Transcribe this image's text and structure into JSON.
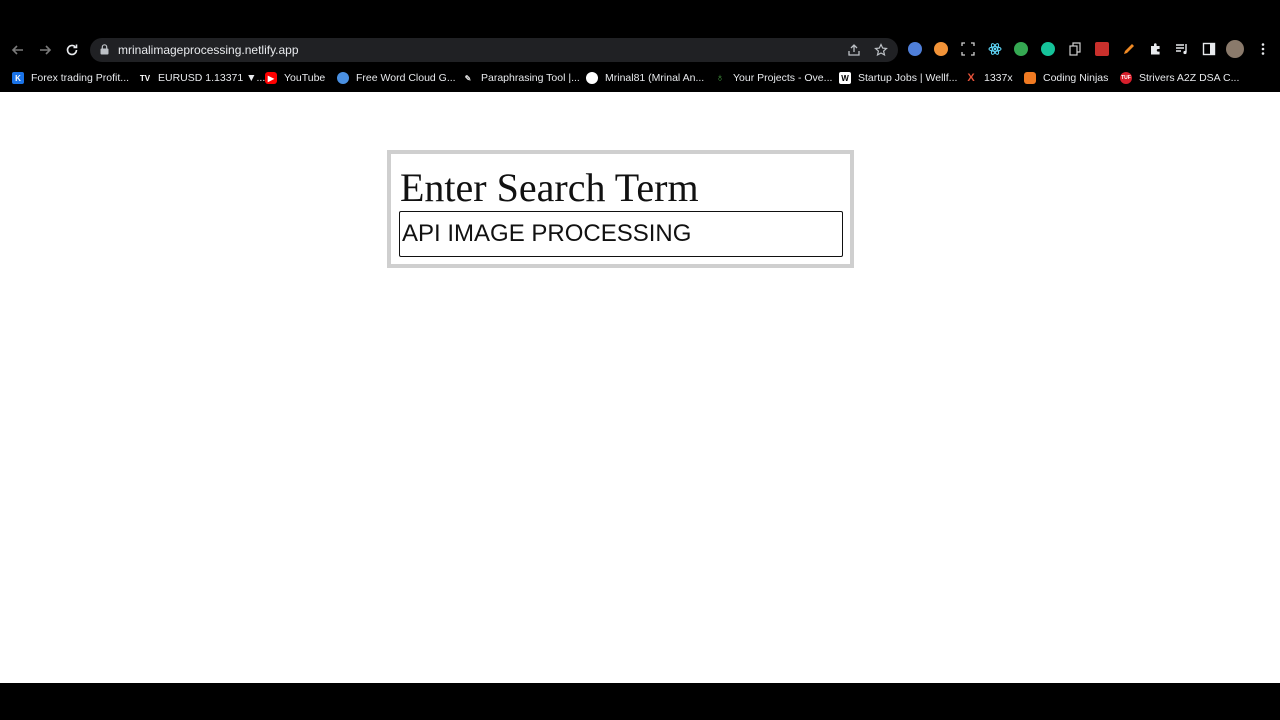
{
  "browser": {
    "url": "mrinalimageprocessing.netlify.app",
    "bookmarks": [
      {
        "label": "Forex trading Profit...",
        "icon": "forex-icon",
        "color": "#1a73e8"
      },
      {
        "label": "EURUSD 1.13371 ▼...",
        "icon": "tradingview-icon",
        "color": "#ffffff"
      },
      {
        "label": "YouTube",
        "icon": "youtube-icon",
        "color": "#ff0000"
      },
      {
        "label": "Free Word Cloud G...",
        "icon": "wordcloud-icon",
        "color": "#4a90e2"
      },
      {
        "label": "Paraphrasing Tool |...",
        "icon": "quill-icon",
        "color": "#dddddd"
      },
      {
        "label": "Mrinal81 (Mrinal An...",
        "icon": "github-icon",
        "color": "#ffffff"
      },
      {
        "label": "Your Projects - Ove...",
        "icon": "overleaf-icon",
        "color": "#47a141"
      },
      {
        "label": "Startup Jobs | Wellf...",
        "icon": "wellfound-icon",
        "color": "#ffffff"
      },
      {
        "label": "1337x",
        "icon": "x-icon",
        "color": "#e8533a"
      },
      {
        "label": "Coding Ninjas",
        "icon": "codingninjas-icon",
        "color": "#f07a22"
      },
      {
        "label": "Strivers A2Z DSA C...",
        "icon": "tuf-icon",
        "color": "#d61f2c"
      }
    ]
  },
  "page": {
    "title": "Enter Search Term",
    "search_value": "API IMAGE PROCESSING"
  }
}
